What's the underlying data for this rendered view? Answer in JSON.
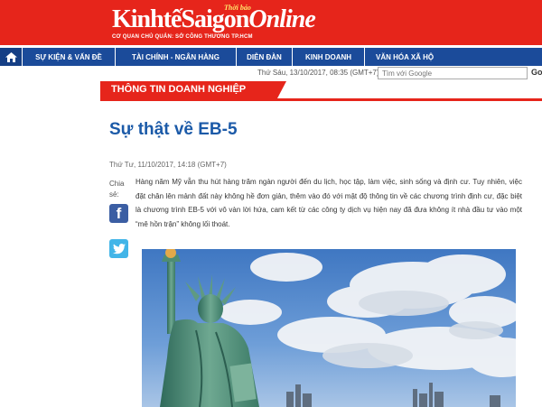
{
  "header": {
    "logo_part1": "KinhtếSaigon",
    "logo_part2": "Online",
    "logo_badge": "Thời báo",
    "logo_subtitle": "CƠ QUAN CHỦ QUẢN: SỞ CÔNG THƯƠNG TP.HCM"
  },
  "nav": {
    "home_icon": "home-icon",
    "items": [
      "SỰ KIỆN & VẤN ĐỀ",
      "TÀI CHÍNH - NGÂN HÀNG",
      "DIỄN ĐÀN",
      "KINH DOANH",
      "VĂN HÓA XÃ HỘ"
    ]
  },
  "topbar": {
    "date": "Thứ Sáu,  13/10/2017, 08:35 (GMT+7)",
    "search_placeholder": "Tìm với Google",
    "search_go": "Go"
  },
  "section": {
    "title": "THÔNG TIN DOANH NGHIỆP"
  },
  "article": {
    "title": "Sự thật về EB-5",
    "date": "Thứ Tư,  11/10/2017, 14:18 (GMT+7)",
    "share_label": "Chia sẻ:",
    "body": "Hàng năm Mỹ vẫn thu hút hàng trăm ngàn người đến du lịch, học tập, làm việc, sinh sống và định cư. Tuy nhiên, việc đặt chân lên mảnh đất này không hề đơn giản, thêm vào đó với mật độ thông tin về các chương trình định cư, đặc biệt là chương trình EB-5 với vô vàn lời hứa, cam kết từ các công ty dịch vụ hiện nay đã đưa không ít nhà đầu tư vào một “mê hồn trận” không lối thoát."
  },
  "colors": {
    "brand_red": "#e6251b",
    "nav_blue": "#1b4b9a",
    "title_blue": "#1b5aa8"
  }
}
